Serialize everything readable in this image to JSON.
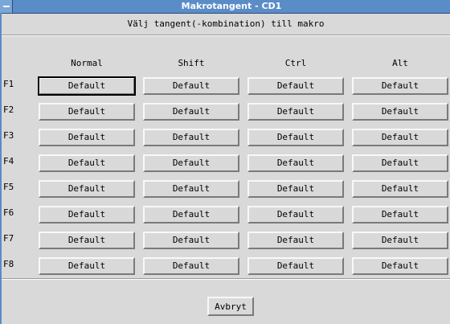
{
  "window": {
    "title": "Makrotangent - CD1",
    "subtitle": "Välj tangent(-kombination) till makro"
  },
  "columns": [
    "Normal",
    "Shift",
    "Ctrl",
    "Alt"
  ],
  "rows": [
    {
      "label": "F1",
      "values": [
        "Default",
        "Default",
        "Default",
        "Default"
      ]
    },
    {
      "label": "F2",
      "values": [
        "Default",
        "Default",
        "Default",
        "Default"
      ]
    },
    {
      "label": "F3",
      "values": [
        "Default",
        "Default",
        "Default",
        "Default"
      ]
    },
    {
      "label": "F4",
      "values": [
        "Default",
        "Default",
        "Default",
        "Default"
      ]
    },
    {
      "label": "F5",
      "values": [
        "Default",
        "Default",
        "Default",
        "Default"
      ]
    },
    {
      "label": "F6",
      "values": [
        "Default",
        "Default",
        "Default",
        "Default"
      ]
    },
    {
      "label": "F7",
      "values": [
        "Default",
        "Default",
        "Default",
        "Default"
      ]
    },
    {
      "label": "F8",
      "values": [
        "Default",
        "Default",
        "Default",
        "Default"
      ]
    }
  ],
  "cancel_label": "Avbryt"
}
